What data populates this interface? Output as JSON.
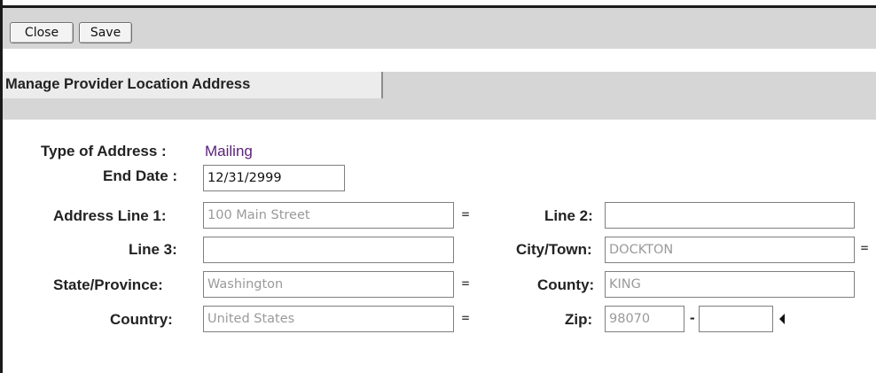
{
  "toolbar": {
    "close_label": "Close",
    "save_label": "Save"
  },
  "section": {
    "title": "Manage Provider Location Address"
  },
  "form": {
    "type_of_address": {
      "label": "Type of Address :",
      "value": "Mailing"
    },
    "end_date": {
      "label": "End Date :",
      "value": "12/31/2999"
    },
    "address_line_1": {
      "label": "Address Line 1:",
      "value": "100 Main Street",
      "required_marker": "="
    },
    "line_2": {
      "label": "Line 2:",
      "value": ""
    },
    "line_3": {
      "label": "Line 3:",
      "value": ""
    },
    "city_town": {
      "label": "City/Town:",
      "value": "DOCKTON",
      "required_marker": "="
    },
    "state_province": {
      "label": "State/Province:",
      "value": "Washington",
      "required_marker": "="
    },
    "county": {
      "label": "County:",
      "value": "KING"
    },
    "country": {
      "label": "Country:",
      "value": "United States",
      "required_marker": "="
    },
    "zip": {
      "label": "Zip:",
      "value": "98070",
      "separator": "-",
      "extension": ""
    }
  },
  "colors": {
    "band": "#d6d6d6",
    "value_text": "#5a1f7a",
    "readonly_text": "#9a9a9a"
  }
}
